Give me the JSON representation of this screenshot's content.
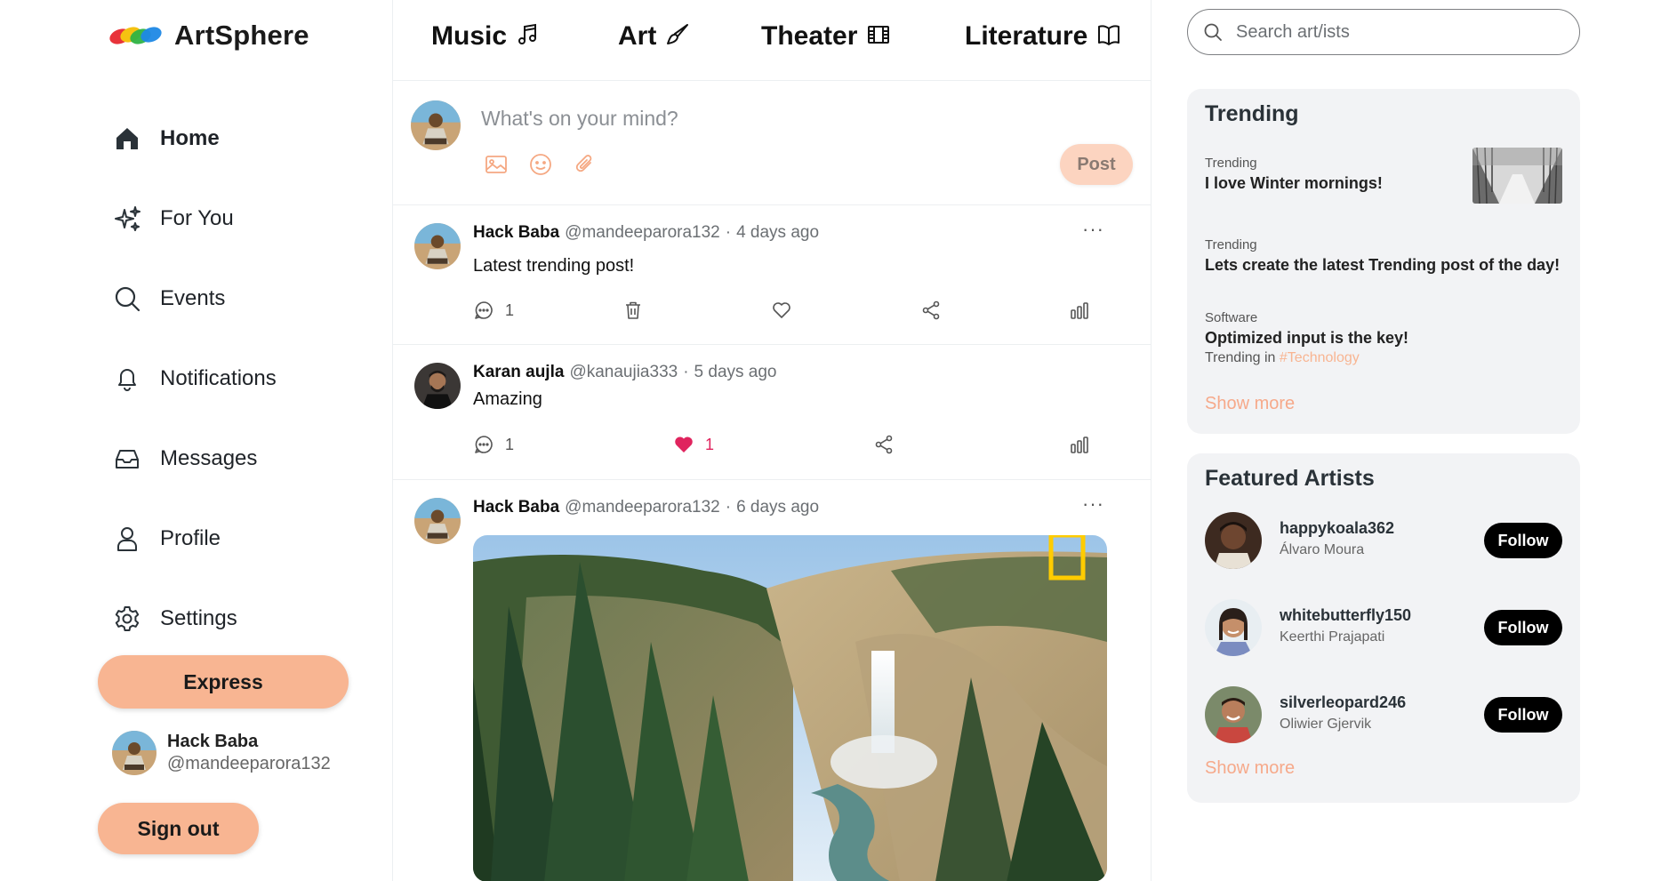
{
  "app": {
    "name": "ArtSphere"
  },
  "sidebar": {
    "nav": [
      {
        "label": "Home",
        "icon": "home-icon",
        "active": true
      },
      {
        "label": "For You",
        "icon": "sparkles-icon",
        "active": false
      },
      {
        "label": "Events",
        "icon": "search-icon",
        "active": false
      },
      {
        "label": "Notifications",
        "icon": "bell-icon",
        "active": false
      },
      {
        "label": "Messages",
        "icon": "inbox-icon",
        "active": false
      },
      {
        "label": "Profile",
        "icon": "user-icon",
        "active": false
      },
      {
        "label": "Settings",
        "icon": "gear-icon",
        "active": false
      }
    ],
    "express_label": "Express",
    "user": {
      "name": "Hack Baba",
      "handle": "@mandeeparora132"
    },
    "signout_label": "Sign out"
  },
  "categories": [
    {
      "label": "Music",
      "icon": "music-note-icon"
    },
    {
      "label": "Art",
      "icon": "brush-icon"
    },
    {
      "label": "Theater",
      "icon": "film-icon"
    },
    {
      "label": "Literature",
      "icon": "book-icon"
    }
  ],
  "composer": {
    "placeholder": "What's on your mind?",
    "post_label": "Post"
  },
  "posts": [
    {
      "author": "Hack Baba",
      "handle": "@mandeeparora132",
      "separator": "·",
      "time": "4 days ago",
      "text": "Latest trending post!",
      "comments": "1",
      "likes": "",
      "liked": false,
      "more": "···"
    },
    {
      "author": "Karan aujla",
      "handle": "@kanaujia333",
      "separator": "·",
      "time": "5 days ago",
      "text": "Amazing",
      "comments": "1",
      "likes": "1",
      "liked": true,
      "more": ""
    },
    {
      "author": "Hack Baba",
      "handle": "@mandeeparora132",
      "separator": "·",
      "time": "6 days ago",
      "text": "",
      "more": "···"
    }
  ],
  "search": {
    "placeholder": "Search art/ists"
  },
  "trending": {
    "title": "Trending",
    "items": [
      {
        "category": "Trending",
        "title": "I love Winter mornings!",
        "sub_prefix": "",
        "sub_tag": ""
      },
      {
        "category": "Trending",
        "title": "Lets create the latest Trending post of the day!",
        "sub_prefix": "",
        "sub_tag": ""
      },
      {
        "category": "Software",
        "title": "Optimized input is the key!",
        "sub_prefix": "Trending in ",
        "sub_tag": "#Technology"
      }
    ],
    "show_more": "Show more"
  },
  "featured": {
    "title": "Featured Artists",
    "artists": [
      {
        "username": "happykoala362",
        "name": "Álvaro Moura",
        "follow_label": "Follow"
      },
      {
        "username": "whitebutterfly150",
        "name": "Keerthi Prajapati",
        "follow_label": "Follow"
      },
      {
        "username": "silverleopard246",
        "name": "Oliwier Gjervik",
        "follow_label": "Follow"
      }
    ],
    "show_more": "Show more"
  },
  "colors": {
    "accent": "#f8b592",
    "accent_text": "#f6a98a",
    "like": "#e0245e",
    "panel_bg": "#f2f3f5"
  }
}
